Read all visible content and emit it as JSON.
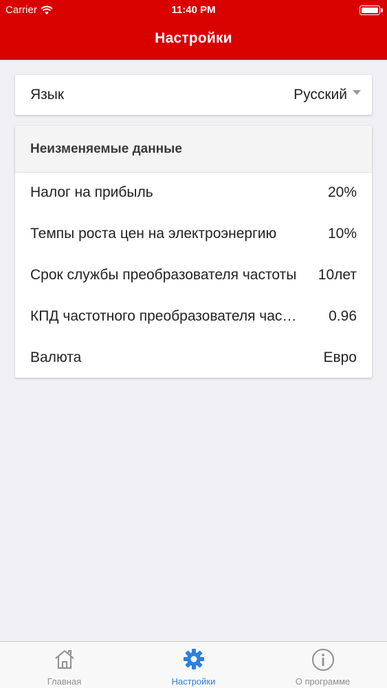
{
  "status_bar": {
    "carrier": "Carrier",
    "time": "11:40 PM"
  },
  "header": {
    "title": "Настройки"
  },
  "language": {
    "label": "Язык",
    "value": "Русский"
  },
  "fixed_data": {
    "title": "Неизменяемые данные",
    "rows": [
      {
        "label": "Налог на прибыль",
        "value": "20%"
      },
      {
        "label": "Темпы роста цен на электроэнергию",
        "value": "10%"
      },
      {
        "label": "Срок службы преобразователя частоты",
        "value": "10лет"
      },
      {
        "label": "КПД частотного преобразователя частоты",
        "value": "0.96"
      },
      {
        "label": "Валюта",
        "value": "Евро"
      }
    ]
  },
  "tabs": [
    {
      "label": "Главная",
      "icon": "home-icon"
    },
    {
      "label": "Настройки",
      "icon": "gear-icon",
      "active": true
    },
    {
      "label": "О программе",
      "icon": "info-icon"
    }
  ],
  "colors": {
    "brand": "#d90000",
    "active_tab": "#2d7fe0",
    "inactive_tab": "#8e8e93"
  }
}
